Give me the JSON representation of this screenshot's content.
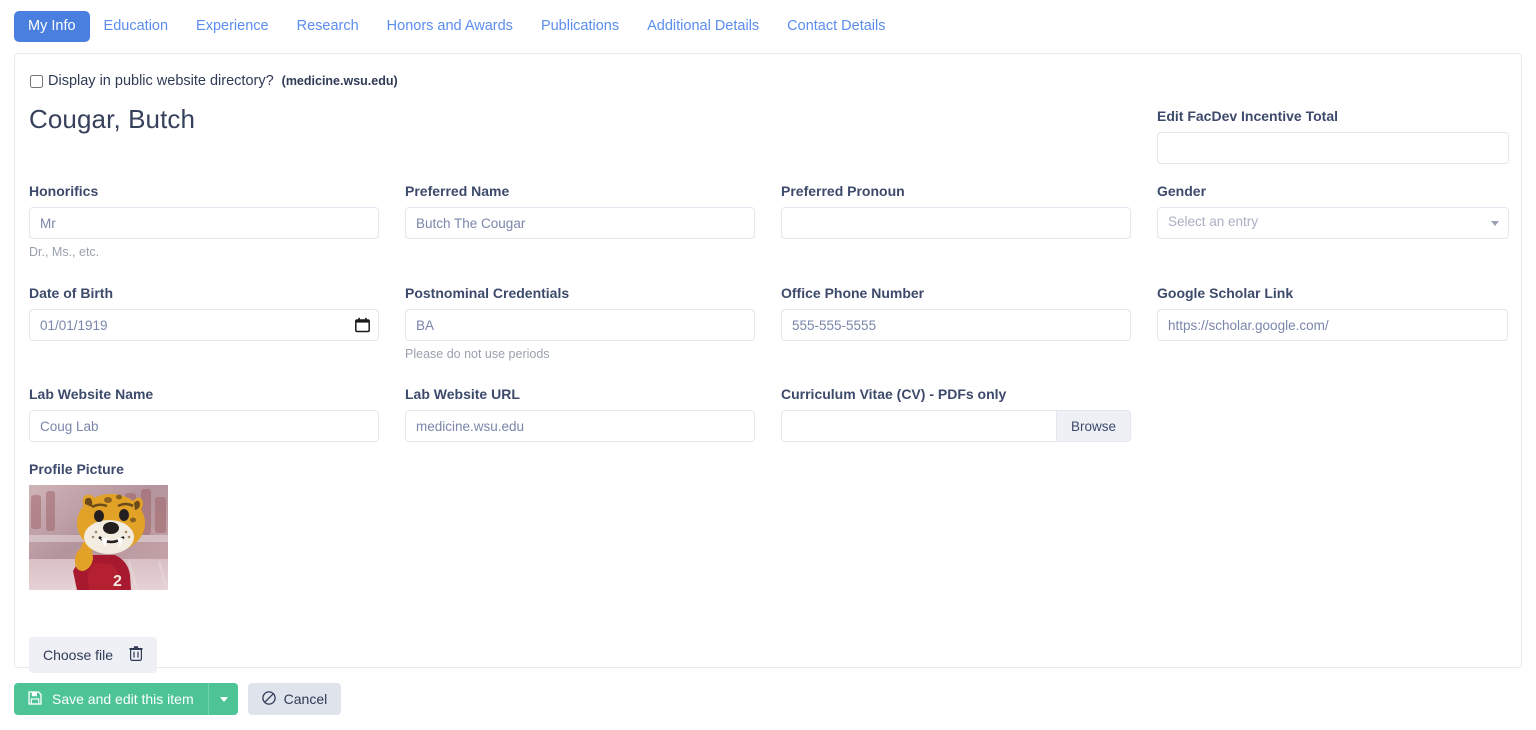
{
  "tabs": [
    {
      "label": "My Info",
      "active": true
    },
    {
      "label": "Education",
      "active": false
    },
    {
      "label": "Experience",
      "active": false
    },
    {
      "label": "Research",
      "active": false
    },
    {
      "label": "Honors and Awards",
      "active": false
    },
    {
      "label": "Publications",
      "active": false
    },
    {
      "label": "Additional Details",
      "active": false
    },
    {
      "label": "Contact Details",
      "active": false
    }
  ],
  "directory": {
    "checkbox_label": "Display in public website directory?",
    "domain": "(medicine.wsu.edu)",
    "checked": false
  },
  "person_name": "Cougar, Butch",
  "fields": {
    "honorifics": {
      "label": "Honorifics",
      "value": "Mr",
      "help": "Dr., Ms., etc."
    },
    "preferred_name": {
      "label": "Preferred Name",
      "value": "Butch The Cougar"
    },
    "preferred_pronoun": {
      "label": "Preferred Pronoun",
      "value": ""
    },
    "gender": {
      "label": "Gender",
      "value": "Select an entry"
    },
    "facdev_total": {
      "label": "Edit FacDev Incentive Total",
      "value": ""
    },
    "date_of_birth": {
      "label": "Date of Birth",
      "value": "01/01/1919"
    },
    "postnominal": {
      "label": "Postnominal Credentials",
      "value": "BA",
      "help": "Please do not use periods"
    },
    "office_phone": {
      "label": "Office Phone Number",
      "value": "555-555-5555"
    },
    "google_scholar": {
      "label": "Google Scholar Link",
      "value": "https://scholar.google.com/"
    },
    "lab_website_name": {
      "label": "Lab Website Name",
      "value": "Coug Lab"
    },
    "lab_website_url": {
      "label": "Lab Website URL",
      "value": "medicine.wsu.edu"
    },
    "cv": {
      "label": "Curriculum Vitae (CV) - PDFs only",
      "value": "",
      "browse_label": "Browse"
    },
    "profile_picture": {
      "label": "Profile Picture",
      "choose_label": "Choose file"
    }
  },
  "footer": {
    "save_label": "Save and edit this item",
    "cancel_label": "Cancel"
  },
  "colors": {
    "tab_active_bg": "#4a7fdf",
    "tab_link": "#5b8def",
    "save_green": "#4cc495",
    "cancel_gray": "#dfe3ec",
    "label_text": "#3d4a6b",
    "input_text": "#7a86ab",
    "card_border": "#e7eaf0"
  }
}
